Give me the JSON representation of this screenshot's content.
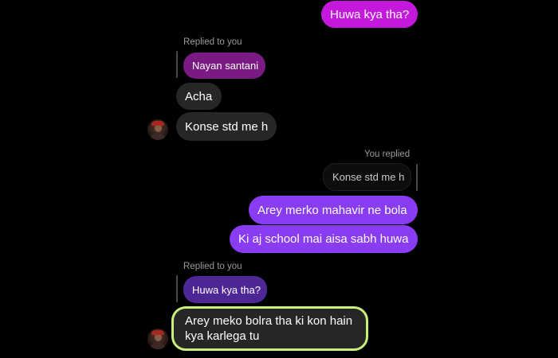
{
  "messages": {
    "m1": "Huwa kya tha?",
    "replied_to_you_1": "Replied to you",
    "quote_1": "Nayan santani",
    "m2": "Acha",
    "m3": "Konse std me h",
    "you_replied": "You replied",
    "quote_2": "Konse std me h",
    "m4": "Arey merko mahavir ne bola",
    "m5": "Ki aj school mai aisa sabh huwa",
    "replied_to_you_2": "Replied to you",
    "quote_3": "Huwa kya tha?",
    "m6": "Arey meko bolra tha ki kon hain kya karlega tu"
  },
  "colors": {
    "sent_pink": "#c418dd",
    "sent_purple": "#8a3cf2",
    "received": "#262626",
    "highlight_border": "#c8f07a"
  }
}
